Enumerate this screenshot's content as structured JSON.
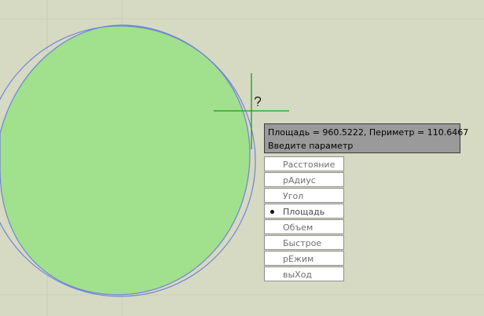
{
  "tooltip": {
    "line1": "Площадь = 960.5222, Периметр = 110.6467",
    "line2": "Введите параметр"
  },
  "menu": {
    "items": [
      {
        "label": "Расстояние",
        "selected": false
      },
      {
        "label": "рАдиус",
        "selected": false
      },
      {
        "label": "Угол",
        "selected": false
      },
      {
        "label": "Площадь",
        "selected": true
      },
      {
        "label": "Объем",
        "selected": false
      },
      {
        "label": "Быстрое",
        "selected": false
      },
      {
        "label": "рЕжим",
        "selected": false
      },
      {
        "label": "выХод",
        "selected": false
      }
    ]
  },
  "colors": {
    "background": "#d6dac2",
    "grid": "#c9cdb6",
    "area_fill": "#a1e08c",
    "outline": "#6f84d6",
    "crosshair": "#1f9a1f"
  }
}
